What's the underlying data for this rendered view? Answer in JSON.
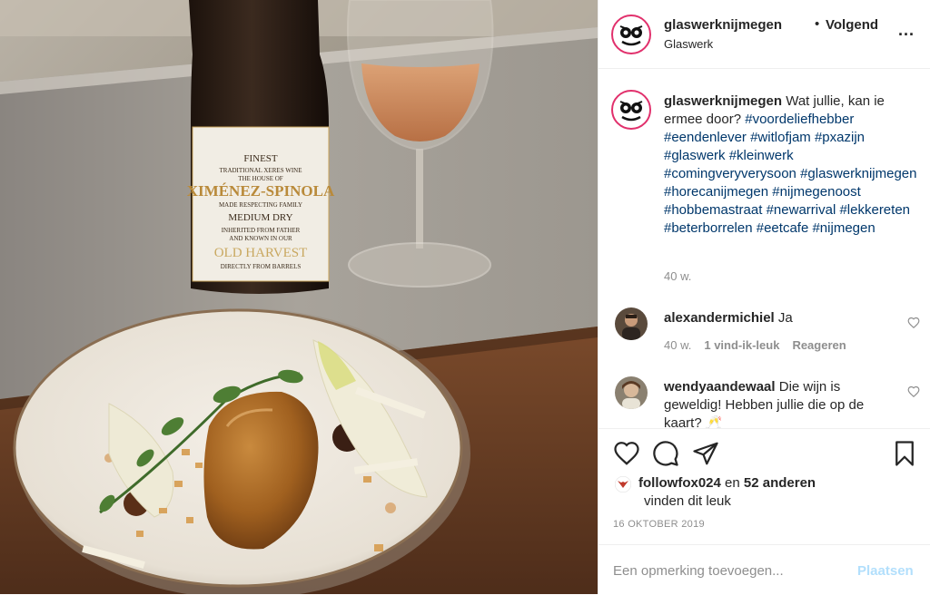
{
  "photo": {
    "label_lines": [
      "FINEST",
      "TRADITIONAL XERES WINE",
      "THE HOUSE OF",
      "XIMÉNEZ-SPINOLA",
      "MADE RESPECTING FAMILY",
      "MEDIUM DRY",
      "INHERITED FROM FATHER",
      "AND KNOWN IN OUR",
      "OLD HARVEST",
      "DIRECTLY FROM BARRELS"
    ]
  },
  "header": {
    "username": "glaswerknijmegen",
    "separator": "•",
    "follow_label": "Volgend",
    "location": "Glaswerk",
    "more_label": "..."
  },
  "caption": {
    "username": "glaswerknijmegen",
    "text": "Wat jullie, kan ie ermee door?",
    "hashtags": [
      "#voordeliefhebber",
      "#eendenlever",
      "#witlofjam",
      "#pxazijn",
      "#glaswerk",
      "#kleinwerk",
      "#comingveryverysoon",
      "#glaswerknijmegen",
      "#horecanijmegen",
      "#nijmegenoost",
      "#hobbemastraat",
      "#newarrival",
      "#lekkereten",
      "#beterborrelen",
      "#eetcafe",
      "#nijmegen"
    ],
    "age": "40 w."
  },
  "comments": [
    {
      "username": "alexandermichiel",
      "text": "Ja",
      "age": "40 w.",
      "likes": "1 vind-ik-leuk",
      "reply": "Reageren"
    },
    {
      "username": "wendyaandewaal",
      "text": "Die wijn is geweldig! Hebben jullie die op de kaart? 🥂"
    }
  ],
  "likes": {
    "user": "followfox024",
    "connector": "en",
    "others": "52 anderen",
    "suffix": "vinden dit leuk"
  },
  "date": "16 OKTOBER 2019",
  "add_comment": {
    "placeholder": "Een opmerking toevoegen...",
    "post_label": "Plaatsen"
  },
  "icons": [
    "heart-icon",
    "comment-icon",
    "share-icon",
    "bookmark-icon",
    "more-icon"
  ],
  "colors": {
    "link": "#00376b",
    "muted": "#8e8e8e",
    "post_disabled": "#b2dffc",
    "story_ring": "#e1306c"
  }
}
